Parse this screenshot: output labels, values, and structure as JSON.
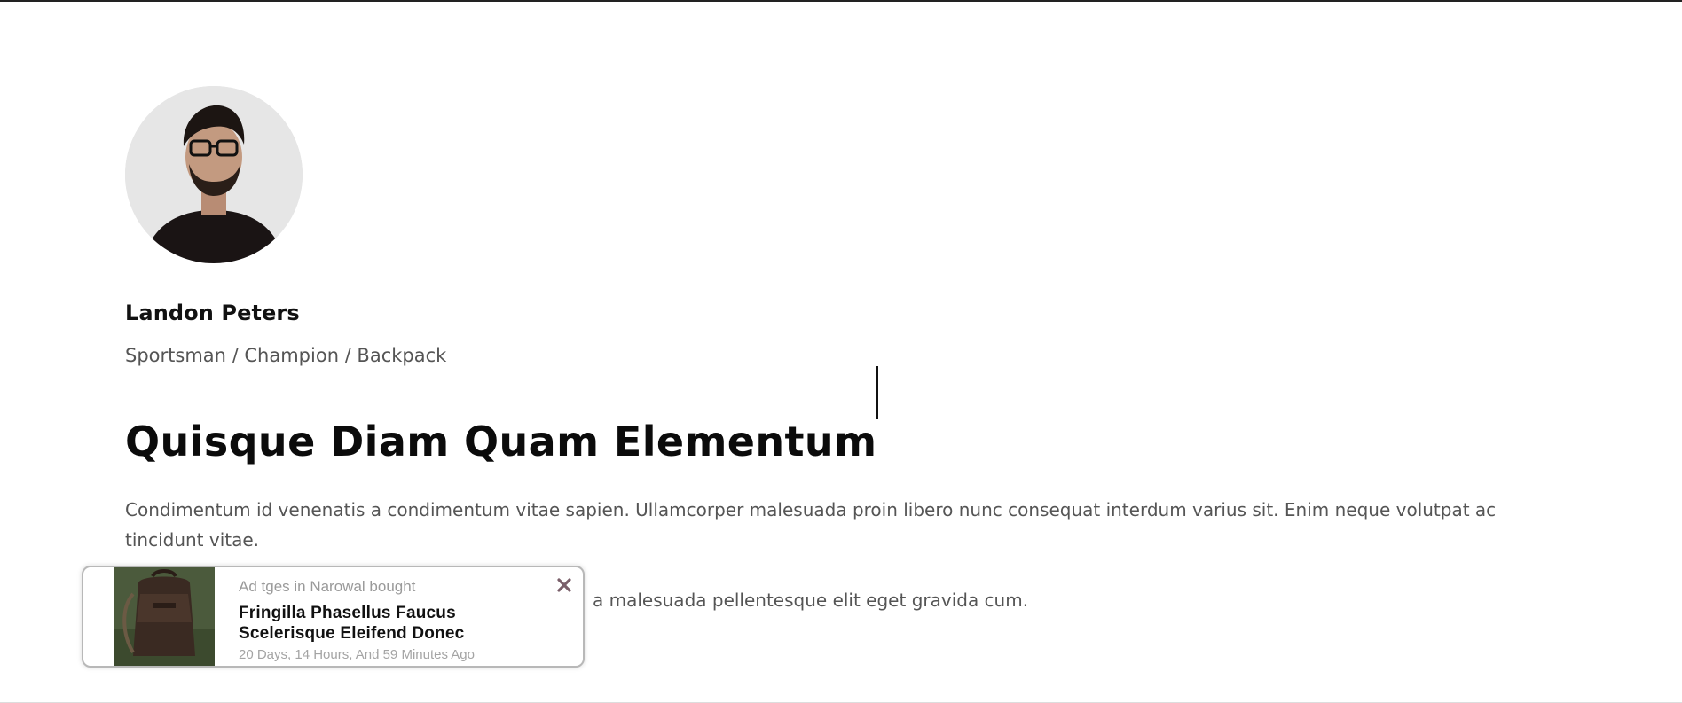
{
  "author": {
    "name": "Landon Peters",
    "tagline": "Sportsman / Champion / Backpack"
  },
  "article": {
    "title": "Quisque Diam Quam Elementum",
    "paragraph1": "Condimentum id venenatis a condimentum vitae sapien. Ullamcorper malesuada proin libero nunc consequat interdum varius sit. Enim neque volutpat ac tincidunt vitae.",
    "paragraph2_visible_end": "a malesuada pellentesque elit eget gravida cum."
  },
  "notification": {
    "meta": "Ad tges in Narowal bought",
    "product_line1": "Fringilla Phasellus Faucus",
    "product_line2": "Scelerisque Eleifend Donec",
    "time": "20 Days, 14 Hours, And 59 Minutes Ago",
    "close_icon": "close-icon",
    "close_color": "#7a5f6a"
  }
}
